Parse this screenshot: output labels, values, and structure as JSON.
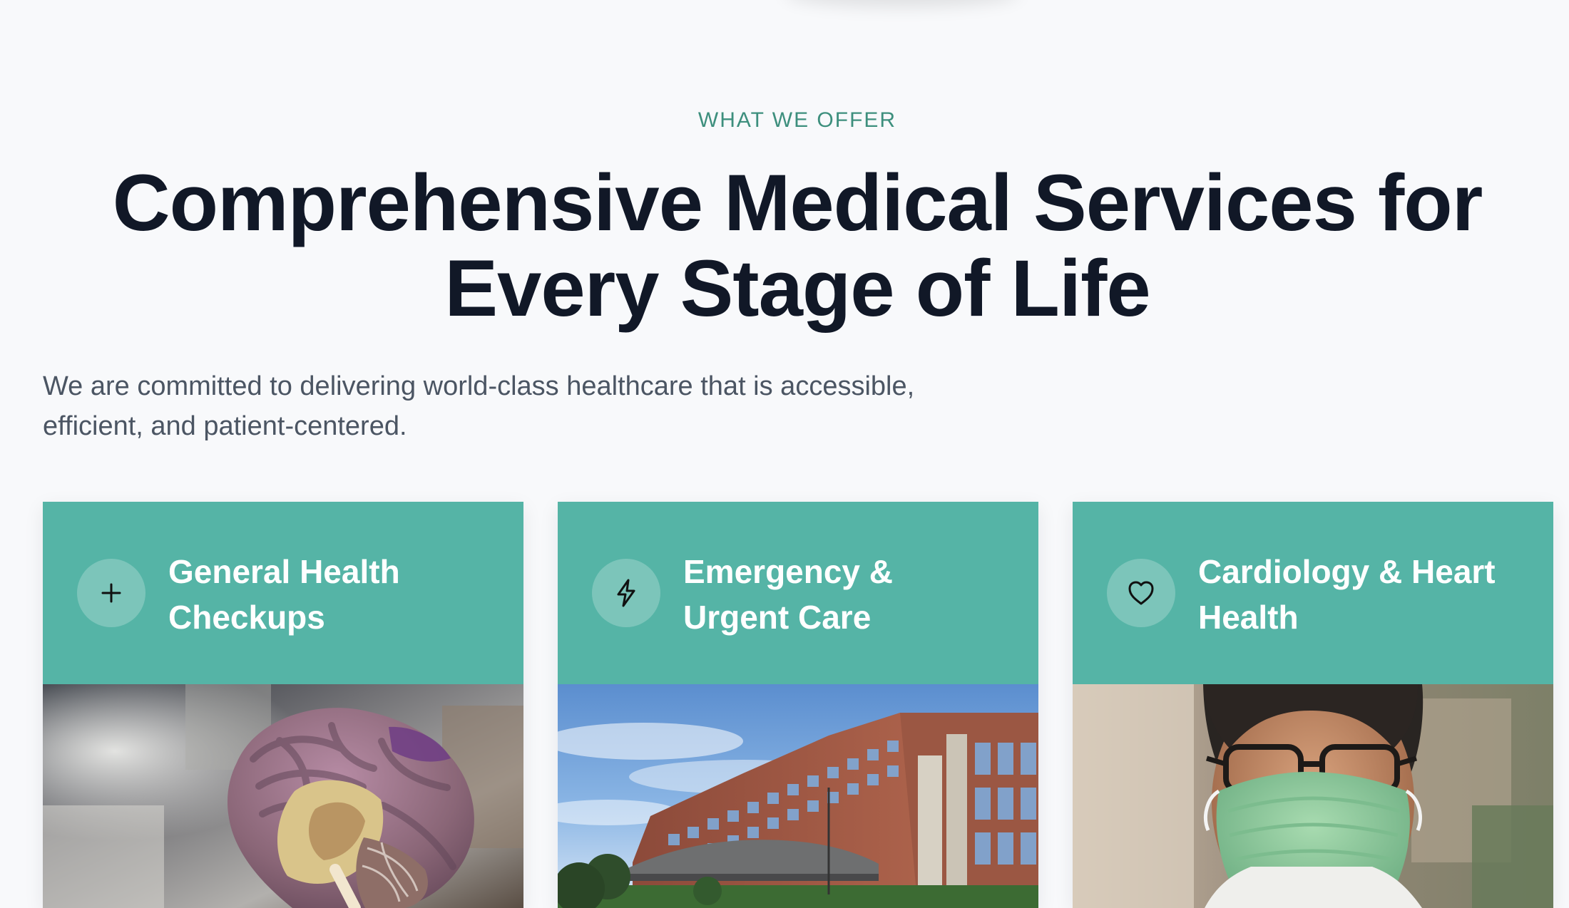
{
  "section": {
    "eyebrow": "WHAT WE OFFER",
    "headline_line1": "Comprehensive Medical Services for",
    "headline_line2": "Every Stage of Life",
    "lead_line1": "We are committed to delivering world-class healthcare that is accessible,",
    "lead_line2": "efficient, and patient-centered."
  },
  "cards": [
    {
      "title_line1": "General Health",
      "title_line2": "Checkups",
      "icon": "plus-icon",
      "image": "brain-model-image"
    },
    {
      "title_line1": "Emergency &",
      "title_line2": "Urgent Care",
      "icon": "lightning-bolt-icon",
      "image": "hospital-building-image"
    },
    {
      "title_line1": "Cardiology & Heart",
      "title_line2": "Health",
      "icon": "heart-icon",
      "image": "masked-doctor-image"
    }
  ],
  "colors": {
    "accent": "#55b4a6",
    "eyebrow": "#3d8f7d",
    "heading": "#111827",
    "body_text": "#4b5563",
    "background": "#f8f9fb"
  }
}
